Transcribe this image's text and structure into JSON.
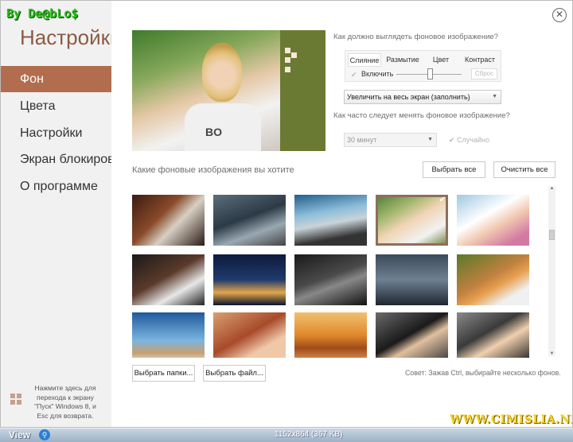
{
  "watermark_top": "By De@bLo$",
  "watermark_bottom": "WWW.CIMISLIA.NET",
  "sidebar": {
    "title": "Настройки",
    "items": [
      {
        "label": "Фон",
        "selected": true
      },
      {
        "label": "Цвета",
        "selected": false
      },
      {
        "label": "Настройки",
        "selected": false
      },
      {
        "label": "Экран блокировки",
        "selected": false
      },
      {
        "label": "О программе",
        "selected": false
      }
    ],
    "footer_text": "Нажмите здесь для перехода к экрану \"Пуск\" Windows 8, и Esc для возврата.",
    "footer_icon": "windows-logo-icon"
  },
  "close_icon": "close-circle-icon",
  "appearance": {
    "question": "Как должно выглядеть фоновое изображение?",
    "tabs": [
      "Слияние",
      "Размытие",
      "Цвет",
      "Контраст"
    ],
    "active_tab": "Слияние",
    "enable_label": "Включить",
    "reset_label": "Сброс",
    "slider_value": 0.55,
    "fit_mode": "Увеличить на весь экран (заполнить)"
  },
  "frequency": {
    "question": "Как часто следует менять фоновое изображение?",
    "interval": "30 минут",
    "random_label": "Случайно"
  },
  "gallery": {
    "heading": "Какие фоновые изображения вы хотите",
    "select_all": "Выбрать все",
    "clear_all": "Очистить все",
    "selected_index": 3,
    "select_folders": "Выбрать папки...",
    "select_files": "Выбрать файл...",
    "tip": "Совет: Зажав Ctrl, выбирайте несколько фонов."
  },
  "viewer_bar": {
    "view_label": "View",
    "dimensions": "1152x864 (367 KB)"
  },
  "colors": {
    "accent": "#b26d4e",
    "sidebar_bg": "#f1f1f1"
  }
}
